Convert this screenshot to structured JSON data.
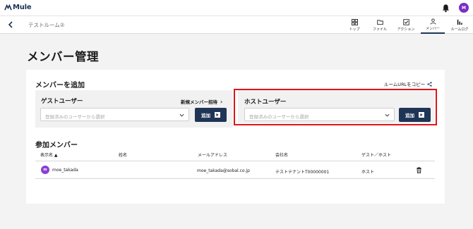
{
  "app": {
    "logo_text": "Mule",
    "avatar_initial": "M"
  },
  "subbar": {
    "room_name": "テストルーム②",
    "tabs": [
      {
        "label": "トップ",
        "icon": "grid-icon"
      },
      {
        "label": "ファイル",
        "icon": "folder-icon"
      },
      {
        "label": "アクション",
        "icon": "checkbox-icon"
      },
      {
        "label": "メンバー",
        "icon": "person-icon",
        "active": true
      },
      {
        "label": "ルームログ",
        "icon": "bar-chart-icon"
      }
    ]
  },
  "page": {
    "title": "メンバー管理"
  },
  "add_section": {
    "title": "メンバーを追加",
    "copy_url": "ルームURLをコピー",
    "guest": {
      "title": "ゲストユーザー",
      "invite_link": "新規メンバー招待",
      "placeholder": "登録済みのユーザーから選択",
      "add_label": "追加"
    },
    "host": {
      "title": "ホストユーザー",
      "placeholder": "登録済みのユーザーから選択",
      "add_label": "追加"
    }
  },
  "members": {
    "title": "参加メンバー",
    "headers": {
      "display_name": "表示名 ▲",
      "name": "姓名",
      "email": "メールアドレス",
      "company": "会社名",
      "role": "ゲスト／ホスト"
    },
    "rows": [
      {
        "avatar": "m",
        "display_name": "moe_takada",
        "name": "",
        "email": "moe_takada@sobal.co.jp",
        "company": "テストテナントT00000001",
        "role": "ホスト"
      }
    ]
  },
  "colors": {
    "accent": "#1e3556",
    "avatar": "#7b2fc4",
    "highlight": "#e0141a"
  }
}
